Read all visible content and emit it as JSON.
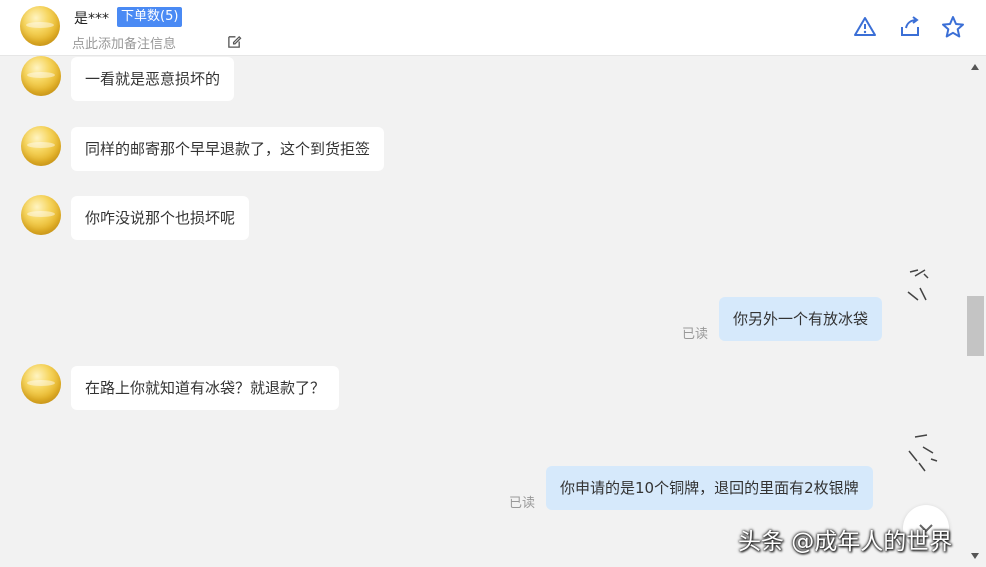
{
  "header": {
    "name": "是***",
    "order_badge": "下单数(5)",
    "note_placeholder": "点此添加备注信息",
    "actions": [
      "warning-icon",
      "share-icon",
      "star-icon"
    ]
  },
  "messages": [
    {
      "side": "in",
      "text": "一看就是恶意损坏的"
    },
    {
      "side": "in",
      "text": "同样的邮寄那个早早退款了，这个到货拒签"
    },
    {
      "side": "in",
      "text": "你咋没说那个也损坏呢"
    },
    {
      "side": "out",
      "text": "你另外一个有放冰袋",
      "status": "已读"
    },
    {
      "side": "in",
      "text": "在路上你就知道有冰袋？就退款了？"
    },
    {
      "side": "out",
      "text": "你申请的是10个铜牌，退回的里面有2枚银牌",
      "status": "已读"
    }
  ],
  "watermark": "头条 @成年人的世界",
  "colors": {
    "badge": "#4a8af4",
    "icon": "#3b6fd6",
    "out_bubble": "#d6e9fb",
    "in_bubble": "#ffffff"
  }
}
